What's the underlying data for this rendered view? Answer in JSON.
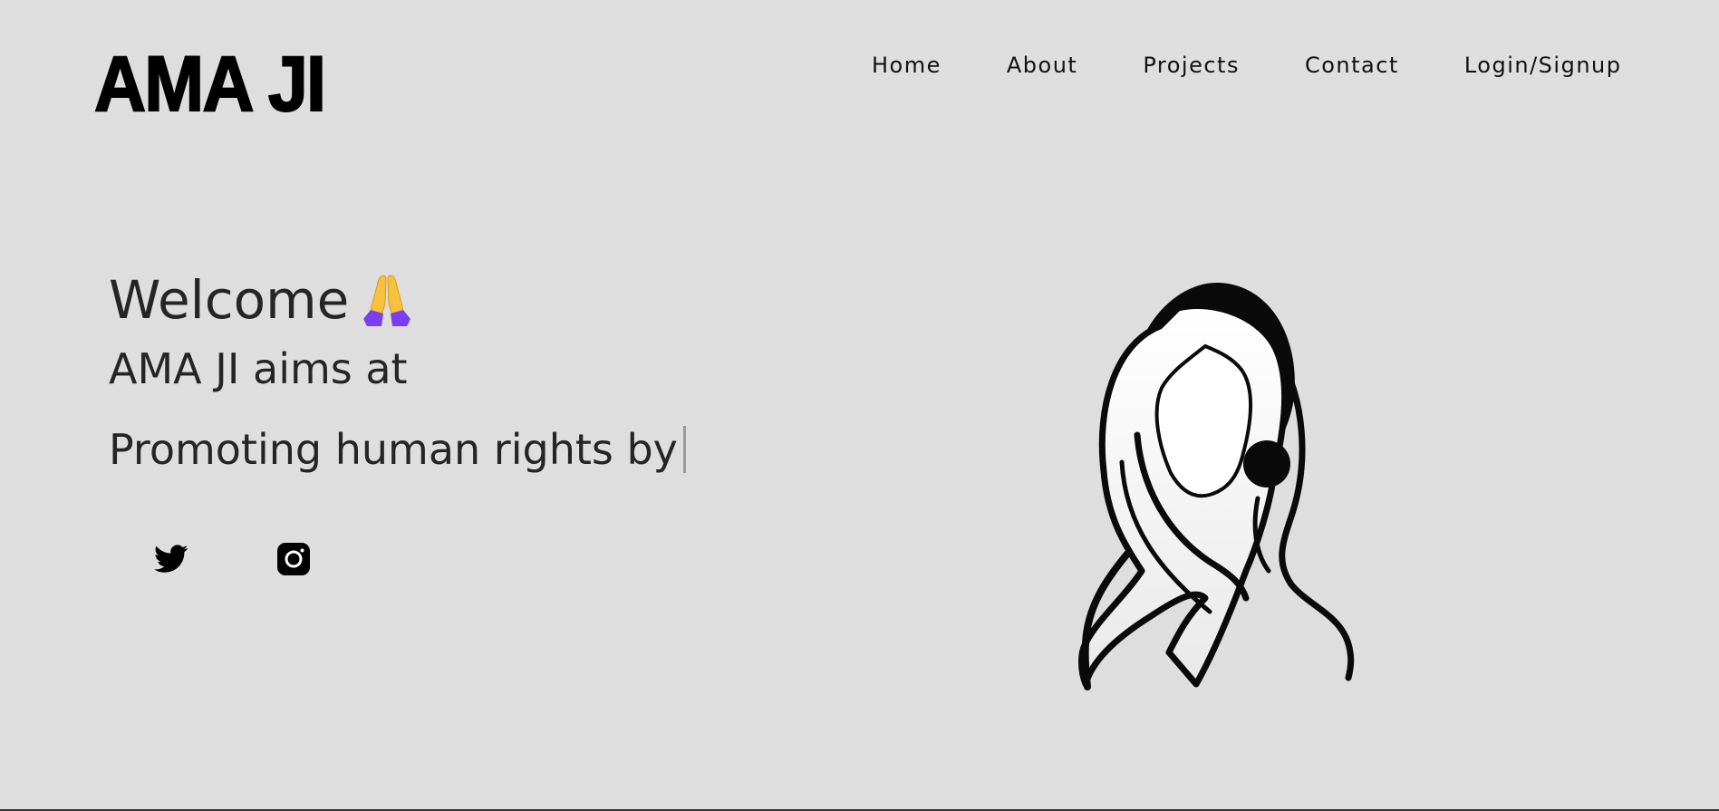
{
  "brand": {
    "logo_text": "AMA JI"
  },
  "nav": {
    "items": [
      {
        "label": "Home"
      },
      {
        "label": "About"
      },
      {
        "label": "Projects"
      },
      {
        "label": "Contact"
      },
      {
        "label": "Login/Signup"
      }
    ]
  },
  "hero": {
    "welcome_text": "Welcome",
    "welcome_icon": "folded-hands-emoji",
    "aims_text": "AMA JI aims at",
    "typed_text": "Promoting human rights by"
  },
  "social": {
    "icons": [
      "twitter-icon",
      "instagram-icon"
    ]
  },
  "illustration": {
    "icon": "woman-headscarf-illustration"
  },
  "colors": {
    "background": "#dedede",
    "text": "#252525",
    "logo": "#000000",
    "emoji_sleeve": "#7b3ff2",
    "emoji_hand": "#f6c13c"
  }
}
